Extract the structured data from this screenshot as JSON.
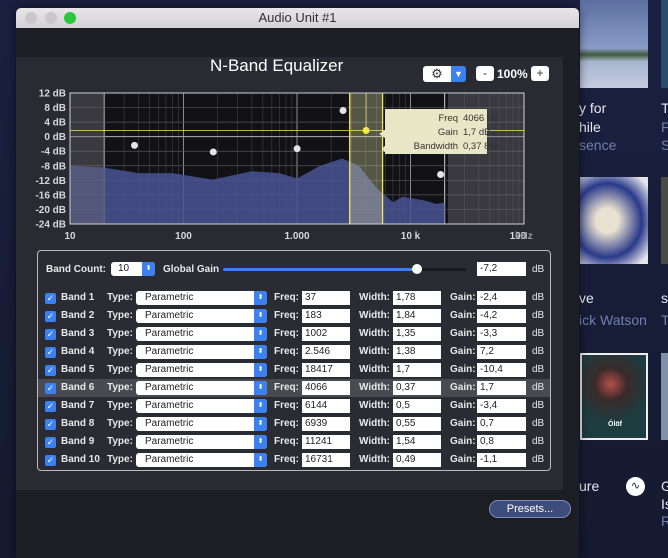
{
  "window": {
    "title": "Audio Unit #1"
  },
  "equalizer": {
    "title": "N-Band Equalizer",
    "zoom": "100%",
    "zoom_minus": "-",
    "zoom_plus": "+",
    "gear_icon": "gear-icon",
    "y_ticks": [
      "12 dB",
      "8 dB",
      "4 dB",
      "0 dB",
      "-4 dB",
      "-8 dB",
      "-12 dB",
      "-16 dB",
      "-20 dB",
      "-24 dB"
    ],
    "x_ticks": [
      "10",
      "100",
      "1.000",
      "10 k",
      "100"
    ],
    "x_unit": "kHz",
    "tooltip": {
      "freq_label": "Freq",
      "freq_value": "4066 Hz",
      "gain_label": "Gain",
      "gain_value": "1,7 dB",
      "bw_label": "Bandwidth",
      "bw_value": "0,37 8ve"
    },
    "selected_band": 6,
    "colors": {
      "accent": "#3b82f0",
      "selection": "#f2ea54",
      "spectrum": "#4a5394"
    }
  },
  "controls": {
    "band_count_label": "Band Count:",
    "band_count": "10",
    "global_gain_label": "Global Gain",
    "global_gain": "-7,2",
    "global_gain_fraction": 0.8,
    "db": "dB",
    "type_label": "Type:",
    "freq_label": "Freq:",
    "width_label": "Width:",
    "gain_label": "Gain:"
  },
  "bands": [
    {
      "name": "Band 1",
      "type": "Parametric",
      "freq": "37",
      "width": "1,78",
      "gain": "-2,4",
      "enabled": true
    },
    {
      "name": "Band 2",
      "type": "Parametric",
      "freq": "183",
      "width": "1,84",
      "gain": "-4,2",
      "enabled": true
    },
    {
      "name": "Band 3",
      "type": "Parametric",
      "freq": "1002",
      "width": "1,35",
      "gain": "-3,3",
      "enabled": true
    },
    {
      "name": "Band 4",
      "type": "Parametric",
      "freq": "2.546",
      "width": "1,38",
      "gain": "7,2",
      "enabled": true
    },
    {
      "name": "Band 5",
      "type": "Parametric",
      "freq": "18417",
      "width": "1,7",
      "gain": "-10,4",
      "enabled": true
    },
    {
      "name": "Band 6",
      "type": "Parametric",
      "freq": "4066",
      "width": "0,37",
      "gain": "1,7",
      "enabled": true
    },
    {
      "name": "Band 7",
      "type": "Parametric",
      "freq": "6144",
      "width": "0,5",
      "gain": "-3,4",
      "enabled": true
    },
    {
      "name": "Band 8",
      "type": "Parametric",
      "freq": "6939",
      "width": "0,55",
      "gain": "0,7",
      "enabled": true
    },
    {
      "name": "Band 9",
      "type": "Parametric",
      "freq": "11241",
      "width": "1,54",
      "gain": "0,8",
      "enabled": true
    },
    {
      "name": "Band 10",
      "type": "Parametric",
      "freq": "16731",
      "width": "0,49",
      "gain": "-1,1",
      "enabled": true
    }
  ],
  "presets_label": "Presets...",
  "background": {
    "texts": [
      "y for",
      "hile",
      "sence",
      "T",
      "F",
      "S",
      "ve",
      "ick Watson",
      "s",
      "T",
      "ure",
      "G",
      "Is",
      "R"
    ],
    "album_text": "Ólöf"
  }
}
